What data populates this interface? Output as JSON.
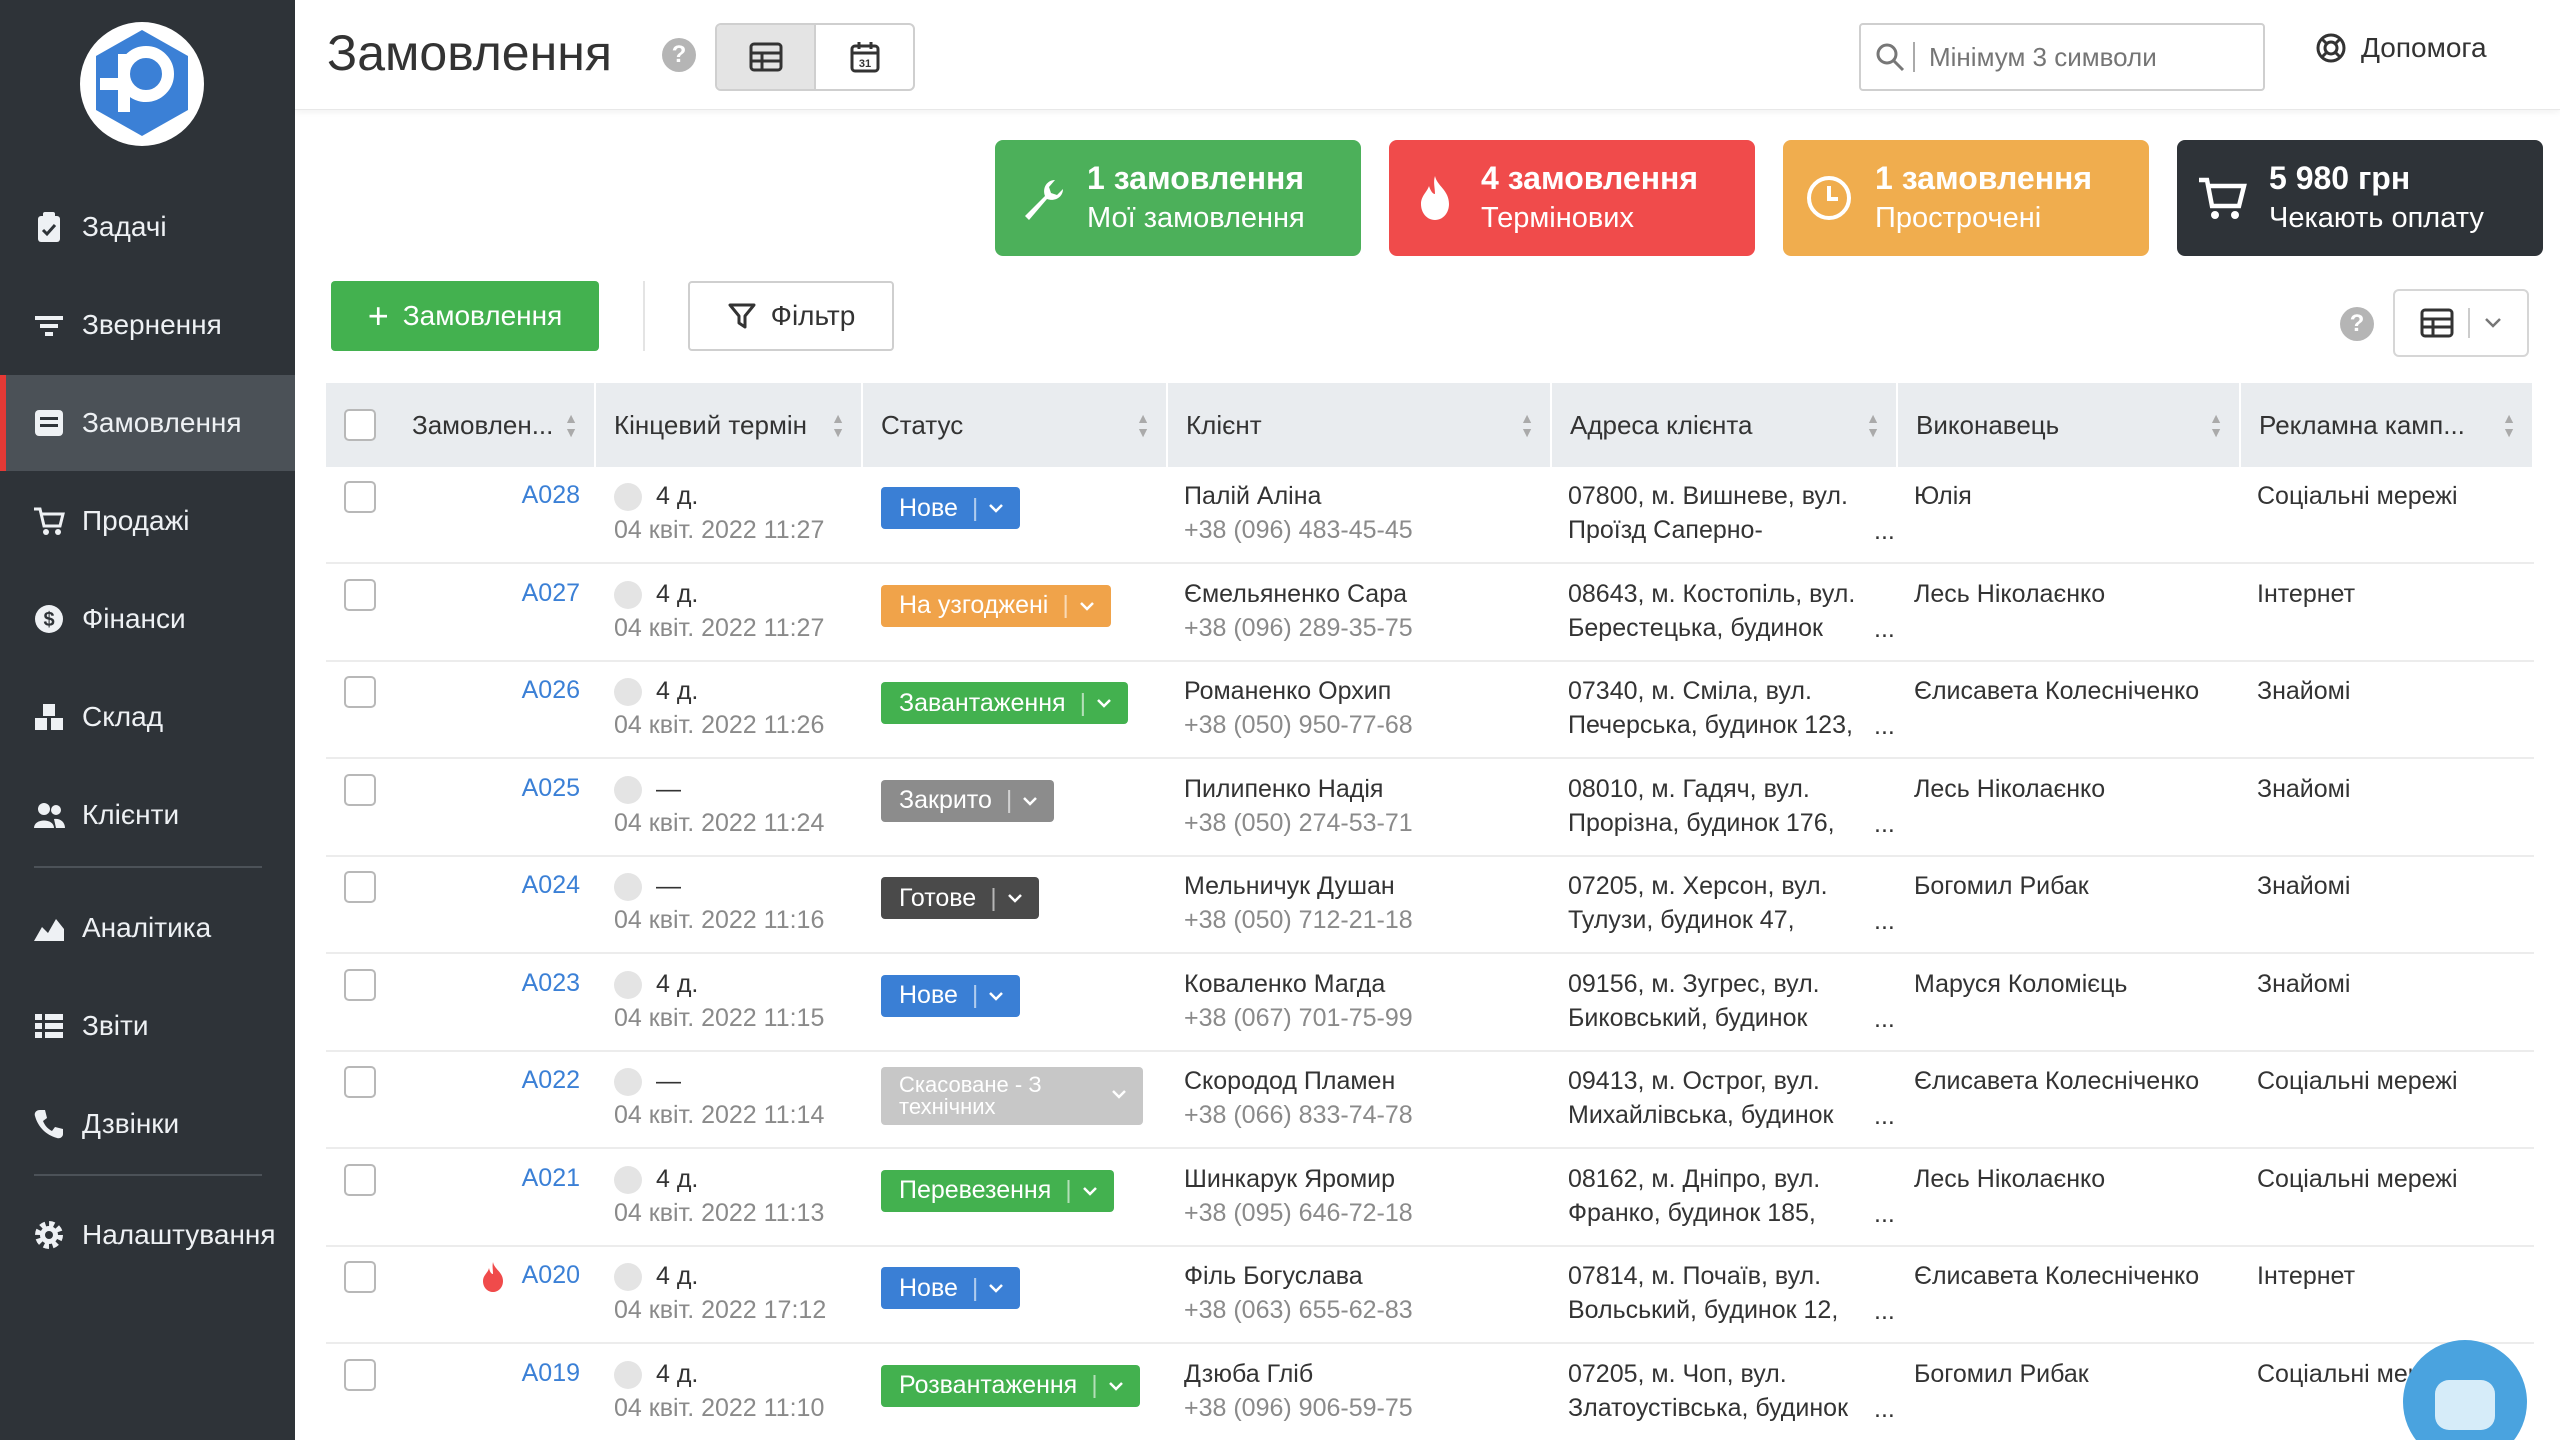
{
  "sidebar": {
    "items": [
      {
        "label": "Задачі",
        "icon": "clipboard-icon"
      },
      {
        "label": "Звернення",
        "icon": "filter-lines-icon"
      },
      {
        "label": "Замовлення",
        "icon": "order-list-icon",
        "active": true
      },
      {
        "label": "Продажі",
        "icon": "cart-icon"
      },
      {
        "label": "Фінанси",
        "icon": "dollar-icon"
      },
      {
        "label": "Склад",
        "icon": "boxes-icon"
      },
      {
        "label": "Клієнти",
        "icon": "users-icon"
      },
      {
        "label": "Аналітика",
        "icon": "chart-area-icon"
      },
      {
        "label": "Звіти",
        "icon": "list-icon"
      },
      {
        "label": "Дзвінки",
        "icon": "phone-icon"
      },
      {
        "label": "Налаштування",
        "icon": "gear-icon"
      }
    ]
  },
  "header": {
    "title": "Замовлення",
    "search_placeholder": "Мінімум 3 символи",
    "help_label": "Допомога"
  },
  "stats": [
    {
      "title": "1 замовлення",
      "subtitle": "Мої замовлення",
      "color": "#4cb05a",
      "icon": "wrench-icon"
    },
    {
      "title": "4 замовлення",
      "subtitle": "Термінових",
      "color": "#f04b4b",
      "icon": "flame-icon"
    },
    {
      "title": "1 замовлення",
      "subtitle": "Прострочені",
      "color": "#f0ad4e",
      "icon": "clock-icon"
    },
    {
      "title": "5 980 грн",
      "subtitle": "Чекають оплату",
      "color": "#2e3338",
      "icon": "cart-icon"
    }
  ],
  "toolbar": {
    "add_label": "Замовлення",
    "add_plus": "+",
    "filter_label": "Фільтр"
  },
  "table": {
    "columns": [
      "Замовлен...",
      "Кінцевий термін",
      "Статус",
      "Клієнт",
      "Адреса клієнта",
      "Виконавець",
      "Рекламна камп..."
    ],
    "rows": [
      {
        "id": "A028",
        "urgent": false,
        "term": "4 д.",
        "date": "04 квіт. 2022 11:27",
        "status": "Нове",
        "status_color": "#3a7fd5",
        "client": "Палій Аліна",
        "phone": "+38 (096) 483-45-45",
        "addr1": "07800, м. Вишневе, вул.",
        "addr2": "Проїзд Саперно-",
        "executor": "Юлія",
        "campaign": "Соціальні мережі"
      },
      {
        "id": "A027",
        "urgent": false,
        "term": "4 д.",
        "date": "04 квіт. 2022 11:27",
        "status": "На узгоджені",
        "status_color": "#f0a34a",
        "client": "Ємельяненко Сара",
        "phone": "+38 (096) 289-35-75",
        "addr1": "08643, м. Костопіль, вул.",
        "addr2": "Берестецька, будинок",
        "executor": "Лесь Ніколаєнко",
        "campaign": "Інтернет"
      },
      {
        "id": "A026",
        "urgent": false,
        "term": "4 д.",
        "date": "04 квіт. 2022 11:26",
        "status": "Завантаження",
        "status_color": "#43b14f",
        "client": "Романенко Орхип",
        "phone": "+38 (050) 950-77-68",
        "addr1": "07340, м. Сміла, вул.",
        "addr2": "Печерська, будинок 123,",
        "executor": "Єлисавета Колесніченко",
        "campaign": "Знайомі"
      },
      {
        "id": "A025",
        "urgent": false,
        "term": "—",
        "date": "04 квіт. 2022 11:24",
        "status": "Закрито",
        "status_color": "#8c8c8c",
        "client": "Пилипенко Надія",
        "phone": "+38 (050) 274-53-71",
        "addr1": "08010, м. Гадяч, вул.",
        "addr2": "Прорізна, будинок 176,",
        "executor": "Лесь Ніколаєнко",
        "campaign": "Знайомі"
      },
      {
        "id": "A024",
        "urgent": false,
        "term": "—",
        "date": "04 квіт. 2022 11:16",
        "status": "Готове",
        "status_color": "#4a4a4a",
        "client": "Мельничук Душан",
        "phone": "+38 (050) 712-21-18",
        "addr1": "07205, м. Херсон, вул.",
        "addr2": "Тулузи, будинок 47,",
        "executor": "Богомил Рибак",
        "campaign": "Знайомі"
      },
      {
        "id": "A023",
        "urgent": false,
        "term": "4 д.",
        "date": "04 квіт. 2022 11:15",
        "status": "Нове",
        "status_color": "#3a7fd5",
        "client": "Коваленко Магда",
        "phone": "+38 (067) 701-75-99",
        "addr1": "09156, м. Зугрес, вул.",
        "addr2": "Биковський, будинок",
        "executor": "Маруся Коломієць",
        "campaign": "Знайомі"
      },
      {
        "id": "A022",
        "urgent": false,
        "term": "—",
        "date": "04 квіт. 2022 11:14",
        "status": "Скасоване - З технічних",
        "status_color": "#9a9a9a",
        "client": "Скородод Пламен",
        "phone": "+38 (066) 833-74-78",
        "addr1": "09413, м. Острог, вул.",
        "addr2": "Михайлівська, будинок",
        "executor": "Єлисавета Колесніченко",
        "campaign": "Соціальні мережі"
      },
      {
        "id": "A021",
        "urgent": false,
        "term": "4 д.",
        "date": "04 квіт. 2022 11:13",
        "status": "Перевезення",
        "status_color": "#43b14f",
        "client": "Шинкарук Яромир",
        "phone": "+38 (095) 646-72-18",
        "addr1": "08162, м. Дніпро, вул.",
        "addr2": "Франко, будинок 185,",
        "executor": "Лесь Ніколаєнко",
        "campaign": "Соціальні мережі"
      },
      {
        "id": "A020",
        "urgent": true,
        "term": "4 д.",
        "date": "04 квіт. 2022 17:12",
        "status": "Нове",
        "status_color": "#3a7fd5",
        "client": "Філь Богуслава",
        "phone": "+38 (063) 655-62-83",
        "addr1": "07814, м. Почаїв, вул.",
        "addr2": "Вольський, будинок 12,",
        "executor": "Єлисавета Колесніченко",
        "campaign": "Інтернет"
      },
      {
        "id": "A019",
        "urgent": false,
        "term": "4 д.",
        "date": "04 квіт. 2022 11:10",
        "status": "Розвантаження",
        "status_color": "#43b14f",
        "client": "Дзюба Гліб",
        "phone": "+38 (096) 906-59-75",
        "addr1": "07205, м. Чоп, вул.",
        "addr2": "Златоустівська, будинок",
        "executor": "Богомил Рибак",
        "campaign": "Соціальні мережі"
      }
    ]
  }
}
